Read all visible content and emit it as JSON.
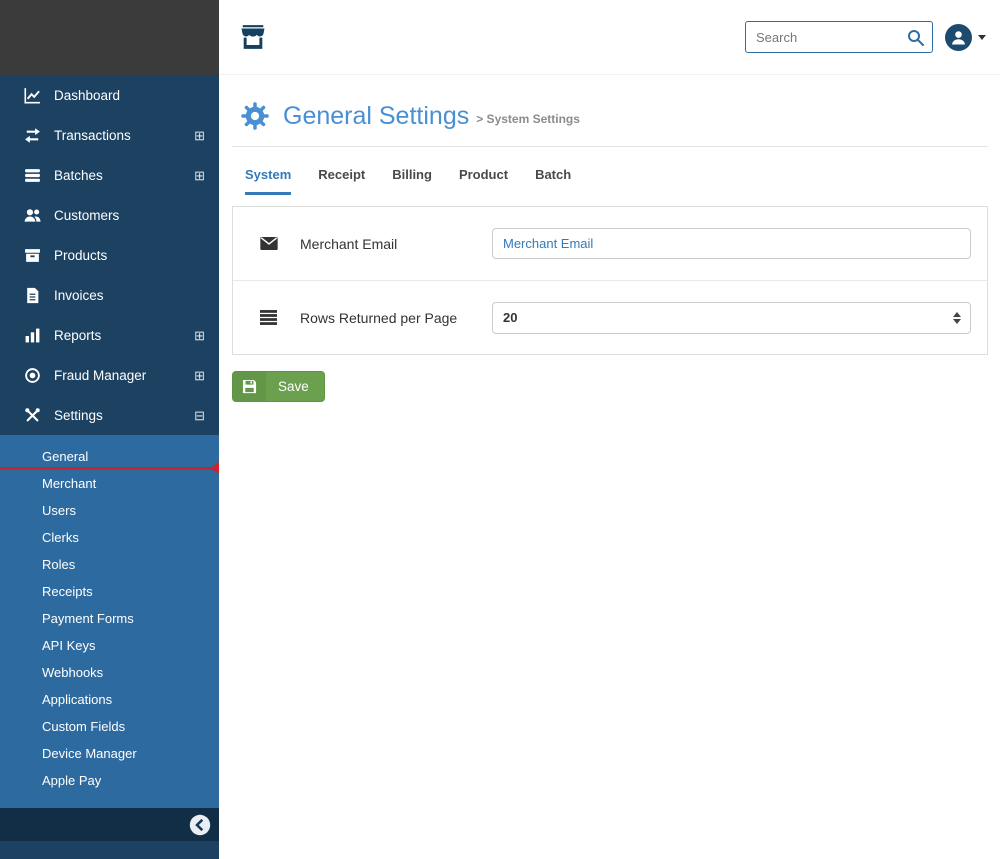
{
  "header": {
    "search_placeholder": "Search"
  },
  "sidebar": {
    "items": [
      {
        "label": "Dashboard",
        "expand": ""
      },
      {
        "label": "Transactions",
        "expand": "⊞"
      },
      {
        "label": "Batches",
        "expand": "⊞"
      },
      {
        "label": "Customers",
        "expand": ""
      },
      {
        "label": "Products",
        "expand": ""
      },
      {
        "label": "Invoices",
        "expand": ""
      },
      {
        "label": "Reports",
        "expand": "⊞"
      },
      {
        "label": "Fraud Manager",
        "expand": "⊞"
      },
      {
        "label": "Settings",
        "expand": "⊟"
      }
    ],
    "submenu": [
      {
        "label": "General"
      },
      {
        "label": "Merchant"
      },
      {
        "label": "Users"
      },
      {
        "label": "Clerks"
      },
      {
        "label": "Roles"
      },
      {
        "label": "Receipts"
      },
      {
        "label": "Payment Forms"
      },
      {
        "label": "API Keys"
      },
      {
        "label": "Webhooks"
      },
      {
        "label": "Applications"
      },
      {
        "label": "Custom Fields"
      },
      {
        "label": "Device Manager"
      },
      {
        "label": "Apple Pay"
      }
    ],
    "active_submenu": "General"
  },
  "page": {
    "title": "General Settings",
    "breadcrumb": "> System Settings",
    "tabs": [
      {
        "label": "System"
      },
      {
        "label": "Receipt"
      },
      {
        "label": "Billing"
      },
      {
        "label": "Product"
      },
      {
        "label": "Batch"
      }
    ],
    "active_tab": "System",
    "form": {
      "email_label": "Merchant Email",
      "email_placeholder": "Merchant Email",
      "rows_label": "Rows Returned per Page",
      "rows_value": "20",
      "save_label": "Save"
    }
  },
  "colors": {
    "sidebar_navy": "#1c4161",
    "submenu_blue": "#2d6a9f",
    "top_block_gray": "#3b3b3b",
    "accent_blue": "#337ab7",
    "title_blue": "#4a8fd3",
    "active_red": "#c9252c",
    "save_green": "#6ba14e"
  }
}
